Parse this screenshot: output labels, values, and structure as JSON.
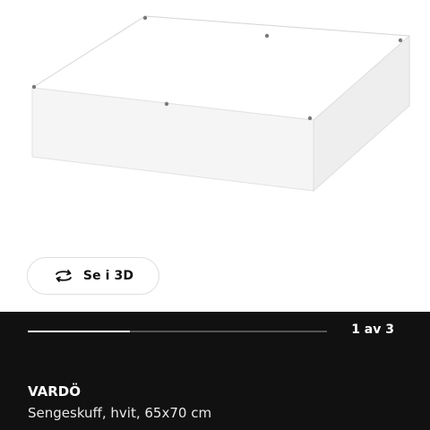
{
  "media": {
    "view_3d_label": "Se i 3D",
    "icon": "rotate-3d-icon"
  },
  "gallery": {
    "page_indicator": "1 av 3",
    "current_image": 1,
    "total_images": 3,
    "progress_fraction": 0.34
  },
  "product": {
    "name": "VARDÖ",
    "description": "Sengeskuff, hvit, 65x70 cm"
  },
  "colors": {
    "panel_background": "#111111",
    "text_primary": "#ffffff",
    "progress_track": "#555555",
    "progress_fill": "#ffffff"
  }
}
